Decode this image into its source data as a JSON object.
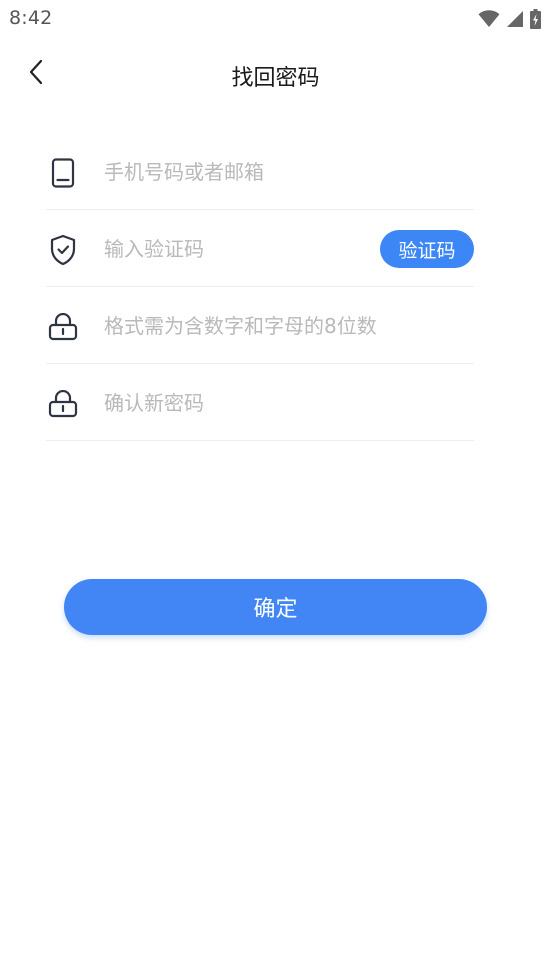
{
  "status_bar": {
    "time": "8:42",
    "icons": [
      "wifi-icon",
      "cell-signal-icon",
      "battery-charging-icon"
    ]
  },
  "header": {
    "title": "找回密码",
    "back_icon": "chevron-left-icon"
  },
  "form": {
    "phone": {
      "icon": "phone-icon",
      "placeholder": "手机号码或者邮箱",
      "value": ""
    },
    "code": {
      "icon": "shield-check-icon",
      "placeholder": "输入验证码",
      "value": "",
      "button_label": "验证码"
    },
    "password": {
      "icon": "lock-icon",
      "placeholder": "格式需为含数字和字母的8位数",
      "value": ""
    },
    "confirm_password": {
      "icon": "lock-icon",
      "placeholder": "确认新密码",
      "value": ""
    }
  },
  "actions": {
    "confirm_label": "确定"
  },
  "colors": {
    "accent": "#3d86f5",
    "icon": "#2f3442",
    "placeholder": "#b9b9b9",
    "divider": "#ededed"
  }
}
